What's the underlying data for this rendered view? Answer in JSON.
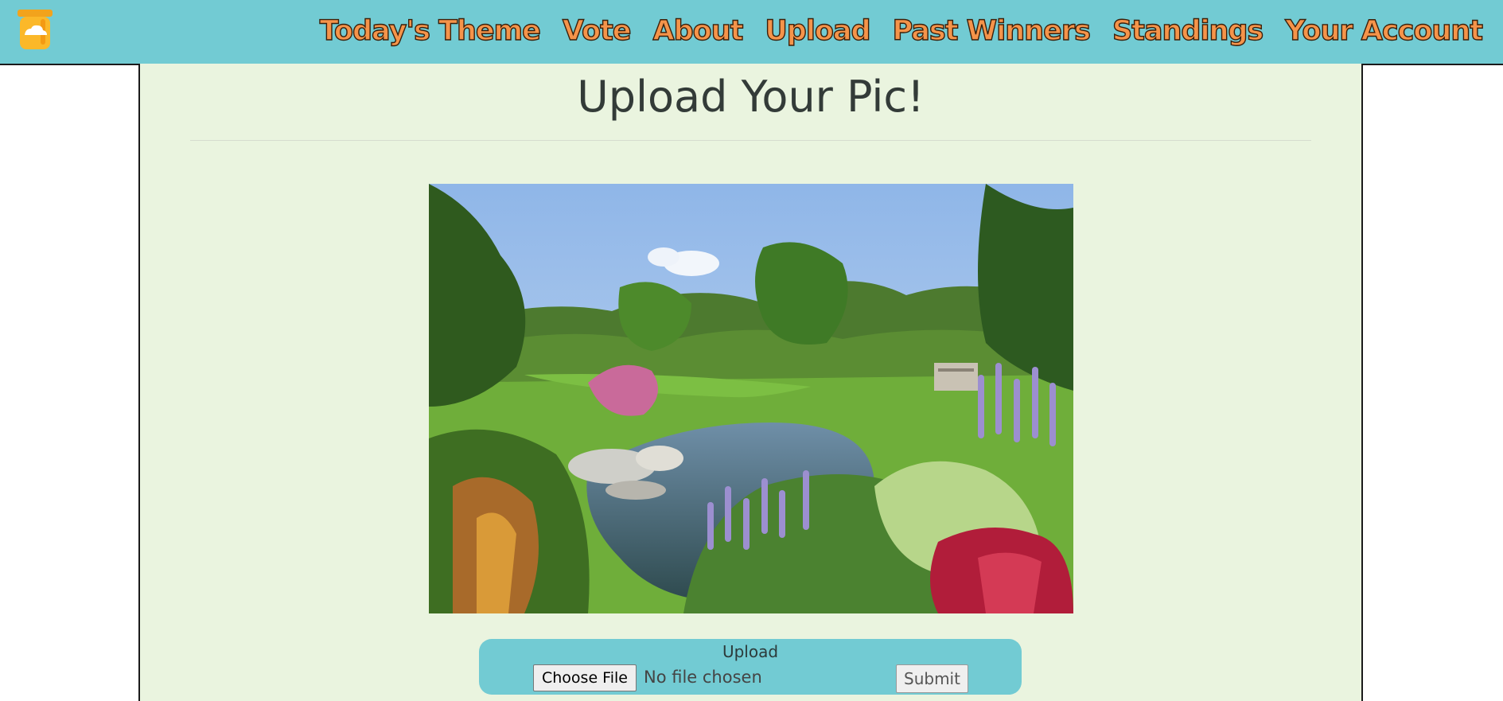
{
  "header": {
    "logo_icon": "honey-jar-logo-icon",
    "nav": [
      {
        "label": "Today's Theme"
      },
      {
        "label": "Vote"
      },
      {
        "label": "About"
      },
      {
        "label": "Upload"
      },
      {
        "label": "Past Winners"
      },
      {
        "label": "Standings"
      },
      {
        "label": "Your Account"
      }
    ]
  },
  "main": {
    "title": "Upload Your Pic!",
    "preview_image": "garden-pond-photo",
    "upload_form": {
      "label": "Upload",
      "choose_file_label": "Choose File",
      "file_status": "No file chosen",
      "submit_label": "Submit"
    }
  },
  "colors": {
    "header_bg": "#72cbd3",
    "nav_text": "#f5944a",
    "panel_bg": "#eaf4df",
    "upload_box_bg": "#72cbd3",
    "title_text": "#333b38"
  }
}
